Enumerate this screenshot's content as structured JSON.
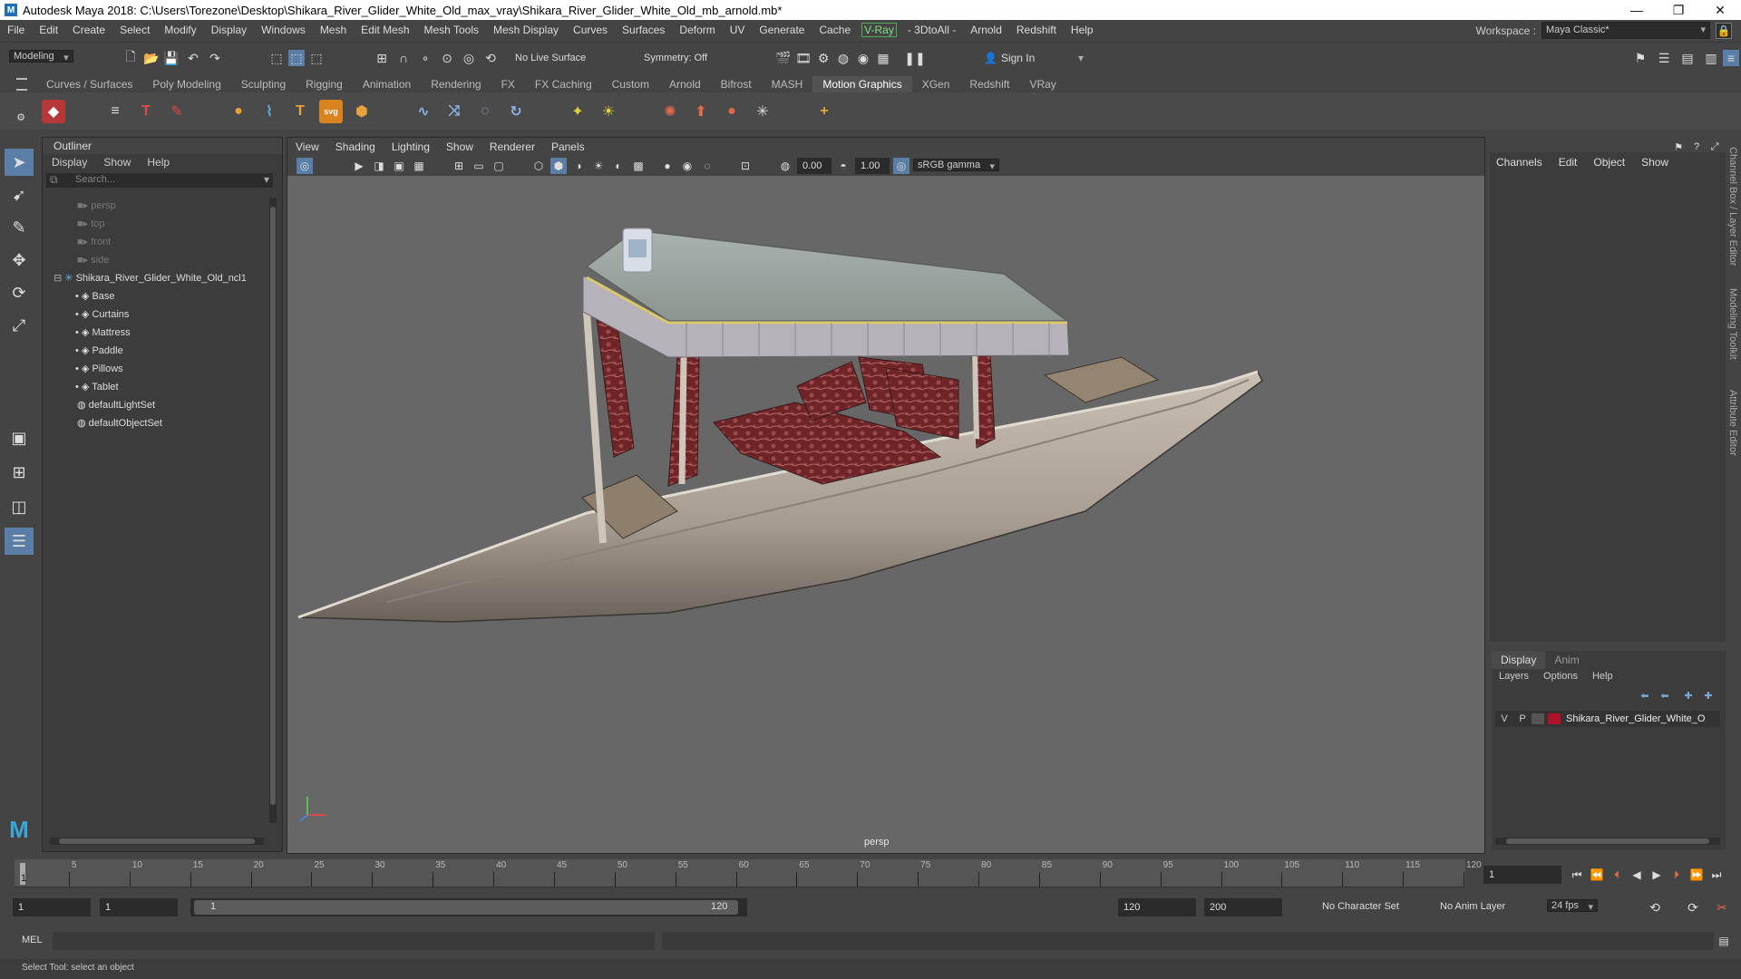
{
  "title_bar": {
    "text": "Autodesk Maya 2018: C:\\Users\\Torezone\\Desktop\\Shikara_River_Glider_White_Old_max_vray\\Shikara_River_Glider_White_Old_mb_arnold.mb*",
    "minimize": "—",
    "restore": "❐",
    "close": "✕"
  },
  "menubar": {
    "items": [
      "File",
      "Edit",
      "Create",
      "Select",
      "Modify",
      "Display",
      "Windows",
      "Mesh",
      "Edit Mesh",
      "Mesh Tools",
      "Mesh Display",
      "Curves",
      "Surfaces",
      "Deform",
      "UV",
      "Generate",
      "Cache"
    ],
    "vray": "V-Ray",
    "items2": [
      "- 3DtoAll -",
      "Arnold",
      "Redshift",
      "Help"
    ],
    "workspace_label": "Workspace :",
    "workspace_value": "Maya Classic*"
  },
  "statusline": {
    "mode": "Modeling",
    "live_surface": "No Live Surface",
    "symmetry": "Symmetry: Off",
    "sign_in": "Sign In"
  },
  "shelf": {
    "tabs": [
      "Curves / Surfaces",
      "Poly Modeling",
      "Sculpting",
      "Rigging",
      "Animation",
      "Rendering",
      "FX",
      "FX Caching",
      "Custom",
      "Arnold",
      "Bifrost",
      "MASH",
      "Motion Graphics",
      "XGen",
      "Redshift",
      "VRay"
    ],
    "active_tab": "Motion Graphics"
  },
  "outliner": {
    "title": "Outliner",
    "menu": [
      "Display",
      "Show",
      "Help"
    ],
    "search_placeholder": "Search...",
    "cameras": [
      "persp",
      "top",
      "front",
      "side"
    ],
    "group": "Shikara_River_Glider_White_Old_ncl1",
    "children": [
      "Base",
      "Curtains",
      "Mattress",
      "Paddle",
      "Pillows",
      "Tablet"
    ],
    "sets": [
      "defaultLightSet",
      "defaultObjectSet"
    ]
  },
  "viewport": {
    "menu": [
      "View",
      "Shading",
      "Lighting",
      "Show",
      "Renderer",
      "Panels"
    ],
    "exposure": "0.00",
    "gamma": "1.00",
    "color_space": "sRGB gamma",
    "camera_label": "persp"
  },
  "channel_box": {
    "menu": [
      "Channels",
      "Edit",
      "Object",
      "Show"
    ],
    "side_labels": [
      "Channel Box / Layer Editor",
      "Modeling Toolkit",
      "Attribute Editor"
    ]
  },
  "layer_editor": {
    "tabs": [
      "Display",
      "Anim"
    ],
    "menu": [
      "Layers",
      "Options",
      "Help"
    ],
    "layer_v": "V",
    "layer_p": "P",
    "layer_name": "Shikara_River_Glider_White_O",
    "layer_color": "#b0102a"
  },
  "timeline": {
    "ticks": [
      "5",
      "10",
      "15",
      "20",
      "25",
      "30",
      "35",
      "40",
      "45",
      "50",
      "55",
      "60",
      "65",
      "70",
      "75",
      "80",
      "85",
      "90",
      "95",
      "100",
      "105",
      "110",
      "115",
      "120"
    ],
    "current_marker": "1",
    "current_frame": "1"
  },
  "range": {
    "start": "1",
    "playback_start": "1",
    "slider_start": "1",
    "slider_end": "120",
    "playback_end": "120",
    "end": "200",
    "character_set": "No Character Set",
    "anim_layer": "No Anim Layer",
    "fps": "24 fps"
  },
  "command": {
    "mel_label": "MEL",
    "help_text": "Select Tool: select an object"
  }
}
